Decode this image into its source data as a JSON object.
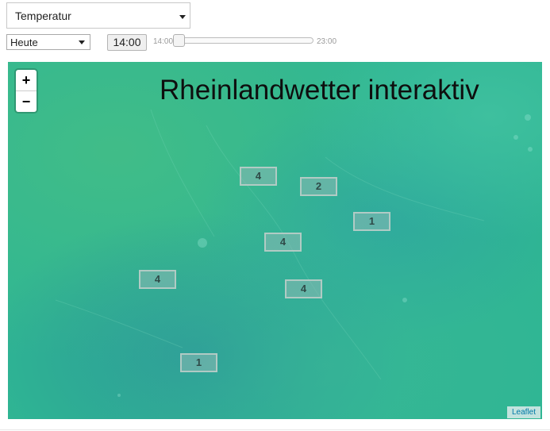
{
  "controls": {
    "parameter_select": {
      "value": "Temperatur"
    },
    "day_select": {
      "value": "Heute"
    },
    "time_button": "14:00",
    "time_slider": {
      "min_label": "14:00",
      "max_label": "23:00",
      "position": 0.0
    }
  },
  "map": {
    "title": "Rheinlandwetter interaktiv",
    "zoom_in": "+",
    "zoom_out": "−",
    "attribution": "Leaflet",
    "markers": [
      "4",
      "2",
      "1",
      "4",
      "4",
      "4",
      "1"
    ]
  },
  "colors": {
    "map_base": "#2fb693",
    "marker_text": "#2f4a48",
    "attribution_link": "#0078a8"
  }
}
